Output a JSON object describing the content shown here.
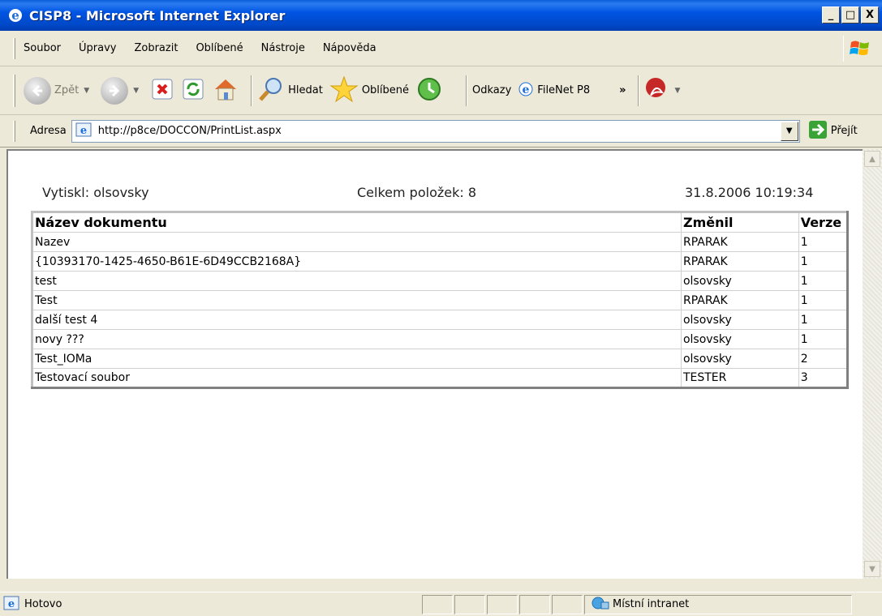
{
  "window": {
    "title": "CISP8 - Microsoft Internet Explorer",
    "buttons": [
      "_",
      "□",
      "X"
    ]
  },
  "menu": [
    {
      "label": "Soubor",
      "key": "S"
    },
    {
      "label": "Úpravy",
      "key": "p"
    },
    {
      "label": "Zobrazit",
      "key": "Z"
    },
    {
      "label": "Oblíbené",
      "key": "O"
    },
    {
      "label": "Nástroje",
      "key": "N"
    },
    {
      "label": "Nápověda",
      "key": "v"
    }
  ],
  "toolbar": {
    "back_label": "Zpět",
    "search_label": "Hledat",
    "favorites_label": "Oblíbené",
    "links_label": "Odkazy",
    "filenet_label": "FileNet P8",
    "chevron": "»"
  },
  "address": {
    "label": "Adresa",
    "url": "http://p8ce/DOCCON/PrintList.aspx",
    "go_label": "Přejít"
  },
  "page": {
    "printed_by": "Vytiskl: olsovsky",
    "total_items": "Celkem položek: 8",
    "timestamp": "31.8.2006 10:19:34",
    "columns": [
      "Název dokumentu",
      "Změnil",
      "Verze"
    ],
    "rows": [
      [
        "Nazev",
        "RPARAK",
        "1"
      ],
      [
        "{10393170-1425-4650-B61E-6D49CCB2168A}",
        "RPARAK",
        "1"
      ],
      [
        "test",
        "olsovsky",
        "1"
      ],
      [
        "Test",
        "RPARAK",
        "1"
      ],
      [
        "další test 4",
        "olsovsky",
        "1"
      ],
      [
        "novy ???",
        "olsovsky",
        "1"
      ],
      [
        "Test_IOMa",
        "olsovsky",
        "2"
      ],
      [
        "Testovací soubor",
        "TESTER",
        "3"
      ]
    ]
  },
  "status": {
    "text": "Hotovo",
    "zone": "Místní intranet"
  },
  "colors": {
    "titlebar": "#0054e3",
    "chrome": "#ece9d8"
  },
  "icons": [
    "ie-icon",
    "windows-logo-icon",
    "back-icon",
    "forward-icon",
    "stop-icon",
    "refresh-icon",
    "home-icon",
    "search-icon",
    "favorites-star-icon",
    "history-icon",
    "pdf-icon",
    "go-arrow-icon",
    "intranet-icon"
  ]
}
